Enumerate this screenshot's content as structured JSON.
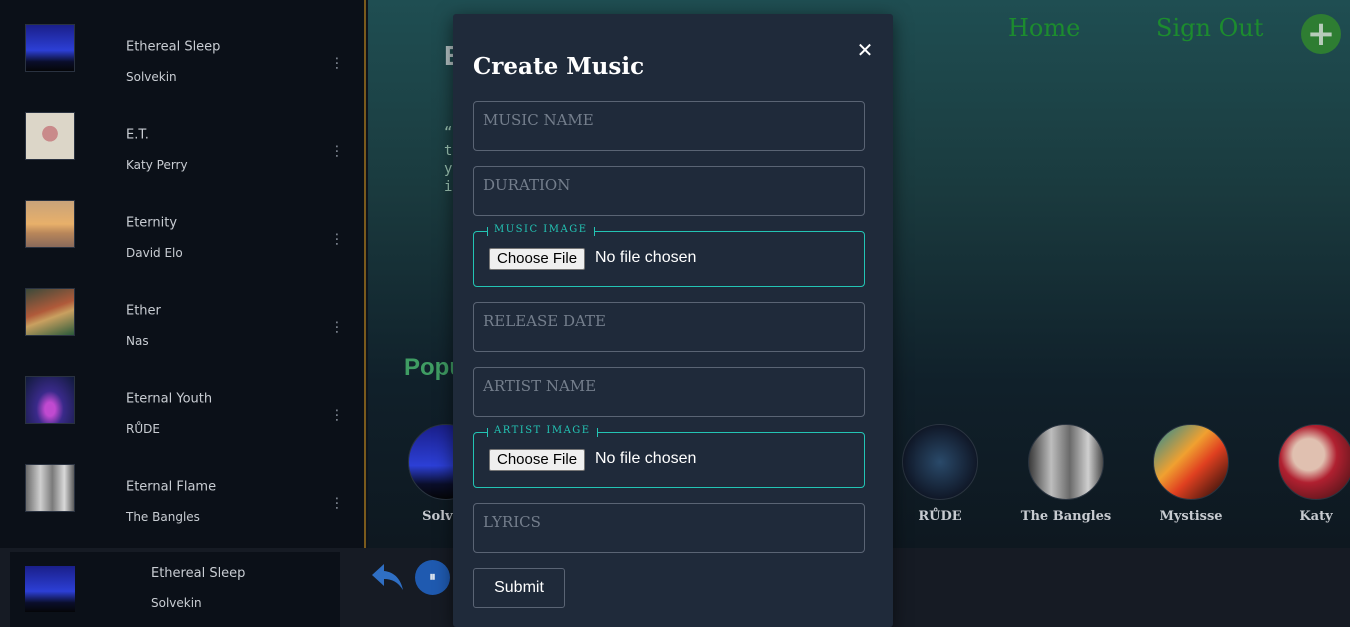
{
  "sidebar": {
    "songs": [
      {
        "title": "Ethereal Sleep",
        "artist": "Solvekin",
        "more": "⋮"
      },
      {
        "title": "E.T.",
        "artist": "Katy Perry",
        "more": "⋮"
      },
      {
        "title": "Eternity",
        "artist": "David Elo",
        "more": "⋮"
      },
      {
        "title": "Ether",
        "artist": "Nas",
        "more": "⋮"
      },
      {
        "title": "Eternal Youth",
        "artist": "RŮDE",
        "more": "⋮"
      },
      {
        "title": "Eternal Flame",
        "artist": "The Bangles",
        "more": "⋮"
      }
    ]
  },
  "nav": {
    "home": "Home",
    "sign_out": "Sign Out",
    "add_icon": "plus-icon",
    "add_symbol": "+"
  },
  "hero": {
    "title_fragment": "E",
    "quote_fragment": "“\nt\ny\ni"
  },
  "popular": {
    "heading_fragment": "Popu",
    "artists": [
      {
        "name": "Solvek"
      },
      {
        "name": "RŮDE"
      },
      {
        "name": "The Bangles"
      },
      {
        "name": "Mystisse"
      },
      {
        "name": "Katy"
      }
    ]
  },
  "player": {
    "now_playing": {
      "title": "Ethereal Sleep",
      "artist": "Solvekin"
    },
    "back_icon": "back-arrow-icon",
    "pause_icon": "pause-icon",
    "pause_symbol": "⏸"
  },
  "modal": {
    "title": "Create Music",
    "close_symbol": "✕",
    "fields": {
      "music_name": {
        "placeholder": "MUSIC NAME"
      },
      "duration": {
        "placeholder": "DURATION"
      },
      "music_image": {
        "legend": "MUSIC IMAGE",
        "button": "Choose File",
        "status": "No file chosen"
      },
      "release_date": {
        "placeholder": "RELEASE DATE"
      },
      "artist_name": {
        "placeholder": "ARTIST NAME"
      },
      "artist_image": {
        "legend": "ARTIST IMAGE",
        "button": "Choose File",
        "status": "No file chosen"
      },
      "lyrics": {
        "placeholder": "LYRICS"
      }
    },
    "submit": "Submit"
  },
  "colors": {
    "accent_green": "#1c8c2e",
    "teal_border": "#23c4b4",
    "modal_bg": "#1f2a3a",
    "player_blue": "#1f5ab0"
  }
}
